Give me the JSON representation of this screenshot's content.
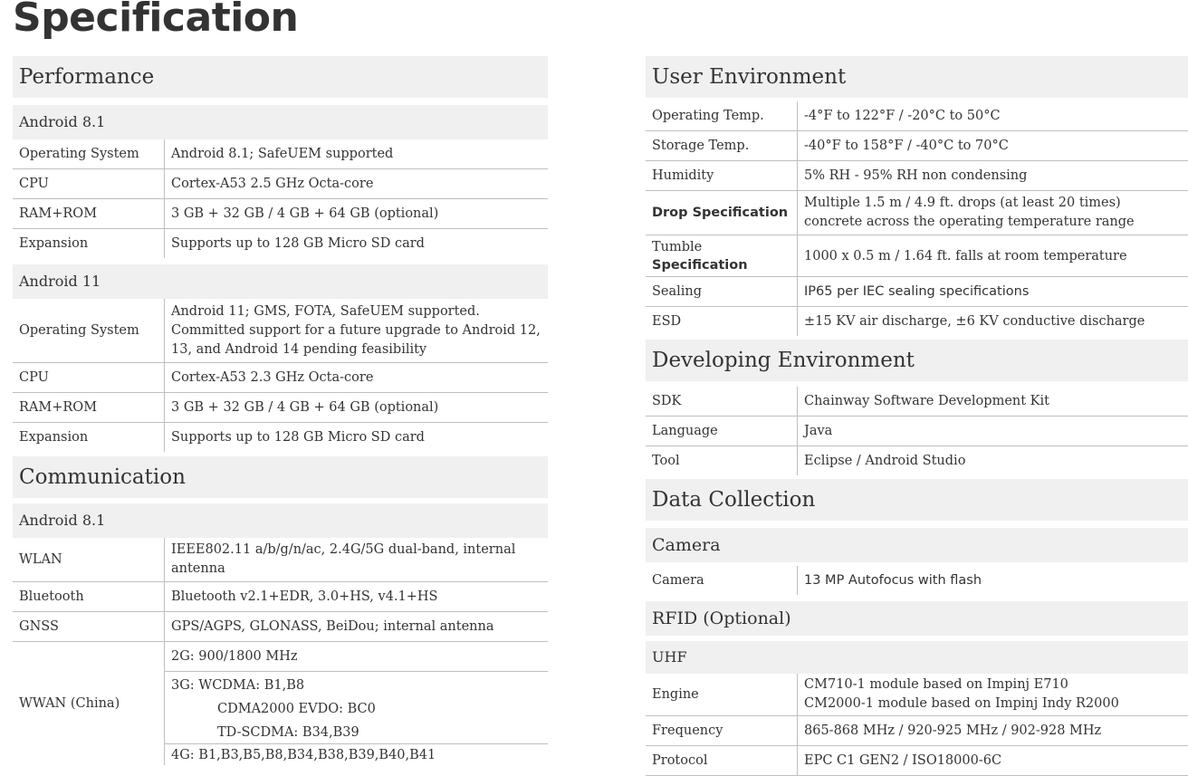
{
  "page_title": "Specification",
  "performance": {
    "title": "Performance",
    "android81": {
      "title": "Android 8.1",
      "rows": [
        {
          "label": "Operating System",
          "value": "Android 8.1; SafeUEM supported"
        },
        {
          "label": "CPU",
          "value": "Cortex-A53 2.5 GHz Octa-core"
        },
        {
          "label": "RAM+ROM",
          "value": "3 GB + 32 GB / 4 GB + 64 GB (optional)"
        },
        {
          "label": "Expansion",
          "value": "Supports up to 128 GB Micro SD card"
        }
      ]
    },
    "android11": {
      "title": "Android 11",
      "os_label": "Operating System",
      "os_value": "Android 11; GMS, FOTA, SafeUEM supported.\nCommitted support for a future upgrade to Android 12,\n13, and Android 14 pending feasibility",
      "rows": [
        {
          "label": "CPU",
          "value": "Cortex-A53 2.3 GHz Octa-core"
        },
        {
          "label": "RAM+ROM",
          "value": "3 GB + 32 GB / 4 GB + 64 GB (optional)"
        },
        {
          "label": "Expansion",
          "value": "Supports up to 128 GB Micro SD card"
        }
      ]
    }
  },
  "communication": {
    "title": "Communication",
    "android81": {
      "title": "Android 8.1",
      "wlan_label": "WLAN",
      "wlan_value": "IEEE802.11 a/b/g/n/ac, 2.4G/5G dual-band, internal\nantenna",
      "rows": [
        {
          "label": "Bluetooth",
          "value": "Bluetooth v2.1+EDR, 3.0+HS, v4.1+HS"
        },
        {
          "label": "GNSS",
          "value": "GPS/AGPS, GLONASS, BeiDou; internal antenna"
        }
      ],
      "wwan": {
        "label": "WWAN (China)",
        "g2": "2G: 900/1800 MHz",
        "g3": "3G: WCDMA: B1,B8",
        "cdma": "CDMA2000 EVDO: BC0",
        "tds": "TD-SCDMA: B34,B39",
        "g4": "4G:  B1,B3,B5,B8,B34,B38,B39,B40,B41"
      }
    }
  },
  "user_env": {
    "title": "User Environment",
    "rows": [
      {
        "label": "Operating Temp.",
        "value": "-4°F to 122°F / -20°C to 50°C"
      },
      {
        "label": "Storage Temp.",
        "value": "-40°F to 158°F / -40°C to 70°C"
      },
      {
        "label": "Humidity",
        "value": "5% RH - 95% RH non condensing"
      }
    ],
    "drop_label": "Drop Specification",
    "drop_value": "Multiple 1.5 m / 4.9 ft. drops (at least 20 times)\nconcrete across the operating temperature range",
    "tumble_label_1": "Tumble",
    "tumble_label_2": "Specification",
    "tumble_value": "1000 x 0.5 m / 1.64 ft. falls at room temperature",
    "sealing_label": "Sealing",
    "sealing_value": "IP65 per IEC sealing specifications",
    "esd_label": "ESD",
    "esd_value": "±15 KV air discharge, ±6 KV conductive discharge"
  },
  "dev_env": {
    "title": "Developing Environment",
    "rows": [
      {
        "label": "SDK",
        "value": "Chainway Software Development Kit"
      },
      {
        "label": "Language",
        "value": "Java"
      },
      {
        "label": "Tool",
        "value": "Eclipse / Android Studio"
      }
    ]
  },
  "data_collection": {
    "title": "Data Collection",
    "camera": {
      "title": "Camera",
      "label": "Camera",
      "value": "13 MP Autofocus with flash"
    },
    "rfid": {
      "title": "RFID (Optional)",
      "uhf_title": "UHF",
      "engine_label": "Engine",
      "engine_value": "CM710-1 module based on Impinj E710\nCM2000-1 module based on Impinj Indy R2000",
      "rows": [
        {
          "label": "Frequency",
          "value": "865-868 MHz / 920-925 MHz / 902-928 MHz"
        },
        {
          "label": "Protocol",
          "value": "EPC C1 GEN2 / ISO18000-6C"
        }
      ]
    }
  }
}
